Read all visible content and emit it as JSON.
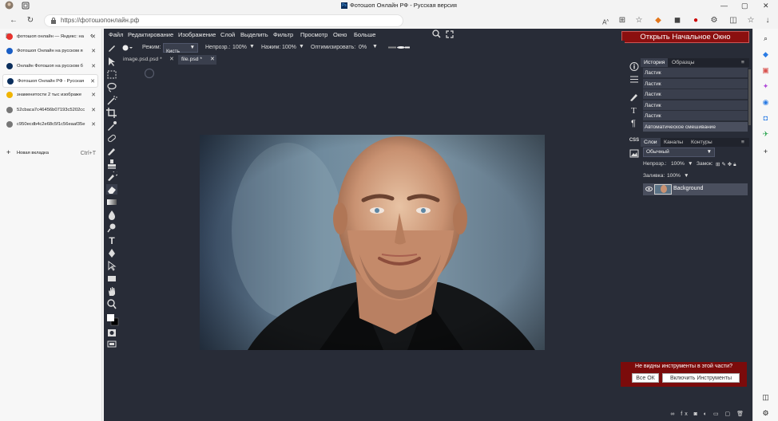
{
  "browser": {
    "window_title": "Фотошоп Онлайн РФ - Русская версия",
    "address": "https://фотошопонлайн.рф",
    "tabs": [
      {
        "label": "фотошоп онлайн — Яндекс: на",
        "icon": "yandex-icon",
        "color": "#e8322d"
      },
      {
        "label": "Фотошоп Онлайн на русском я",
        "icon": "site-icon",
        "color": "#1a5ec5"
      },
      {
        "label": "Онлайн Фотошоп на русском б",
        "icon": "ps-icon",
        "color": "#0a2e5c"
      },
      {
        "label": "Фотошоп Онлайн РФ - Русская",
        "icon": "ps-icon",
        "color": "#0a2e5c",
        "active": true
      },
      {
        "label": "знаменитости 2 тыс изображе",
        "icon": "images-icon",
        "color": "#f0b400"
      },
      {
        "label": "52cbaca7c46456b07193c5202cc",
        "icon": "file-icon",
        "color": "#777"
      },
      {
        "label": "c950ecdb4c2e68c5f1c56eaaf35e",
        "icon": "file-icon",
        "color": "#777"
      }
    ],
    "new_tab": {
      "label": "Новая вкладка",
      "shortcut": "Ctrl+T"
    }
  },
  "ps": {
    "menu": [
      "Файл",
      "Редактирование",
      "Изображение",
      "Слой",
      "Выделить",
      "Фильтр",
      "Просмотр",
      "Окно",
      "Больше"
    ],
    "open_button": "Открыть Начальное Окно",
    "options": {
      "mode_label": "Режим:",
      "mode_value": "Кисть",
      "opacity_label": "Непрозр.:",
      "opacity_value": "100%",
      "pressure_label": "Нажим:",
      "pressure_value": "100%",
      "optimize_label": "Оптимизировать:",
      "optimize_value": "0%"
    },
    "doc_tabs": [
      "image.psd.psd *",
      "file.psd *"
    ],
    "panel_tabs_top": [
      "История",
      "Образцы"
    ],
    "history": [
      "Ластик",
      "Ластик",
      "Ластик",
      "Ластик",
      "Ластик",
      "Автоматическое смешивание"
    ],
    "panel_tabs_layers": [
      "Слои",
      "Каналы",
      "Контуры"
    ],
    "blend_mode": "Обычный",
    "layer_opacity_label": "Непрозр.:",
    "layer_opacity_value": "100%",
    "lock_label": "Замок:",
    "fill_label": "Заливка:",
    "fill_value": "100%",
    "layer_name": "Background",
    "css_label": "CSS",
    "warning": {
      "text": "Не видны инструменты в этой части?",
      "ok": "Все ОК",
      "enable": "Включить Инструменты"
    }
  },
  "colors": {
    "ps_bg": "#282c37",
    "accent_red": "#8b0f0f",
    "panel": "#3a3f4d"
  }
}
